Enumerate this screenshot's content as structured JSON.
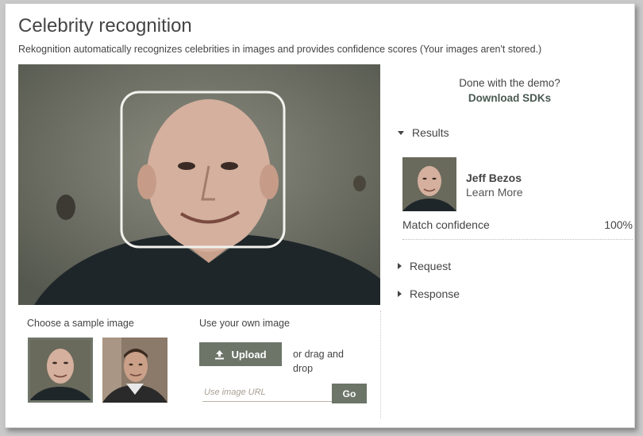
{
  "header": {
    "title": "Celebrity recognition",
    "subtitle": "Rekognition automatically recognizes celebrities in images and provides confidence scores (Your images aren't stored.)"
  },
  "demo": {
    "done_text": "Done with the demo?",
    "download_link": "Download SDKs"
  },
  "results": {
    "section_label": "Results",
    "celebrity_name": "Jeff Bezos",
    "learn_more": "Learn More",
    "match_label": "Match confidence",
    "match_value": "100%"
  },
  "sections": {
    "request_label": "Request",
    "response_label": "Response"
  },
  "samples": {
    "label": "Choose a sample image"
  },
  "own_image": {
    "label": "Use your own image",
    "upload_label": "Upload",
    "drag_text": "or drag and drop",
    "url_placeholder": "Use image URL",
    "go_label": "Go"
  },
  "colors": {
    "button": "#6c7568",
    "accent_link": "#4a5a52",
    "face_box": "#f2f2ee"
  },
  "icons": {
    "upload": "upload-icon",
    "expanded": "triangle-down-icon",
    "collapsed": "triangle-right-icon"
  }
}
